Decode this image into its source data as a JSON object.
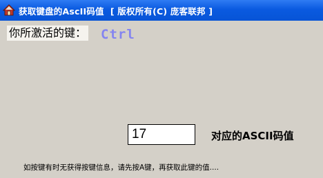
{
  "window": {
    "title": "获取键盘的AscII码值  [ 版权所有(C) 庞客联邦 ]",
    "icon": "house-app-icon"
  },
  "main": {
    "key_prompt": "你所激活的键：",
    "active_key": "Ctrl",
    "ascii_value": "17",
    "ascii_label": "对应的ASCII码值",
    "hint": "如按键有时无获得按键信息，请先按A键，再获取此键的值...."
  },
  "colors": {
    "titlebar": "#0a5ae0",
    "key_text": "#8484f0",
    "background": "#d4d0c8"
  }
}
